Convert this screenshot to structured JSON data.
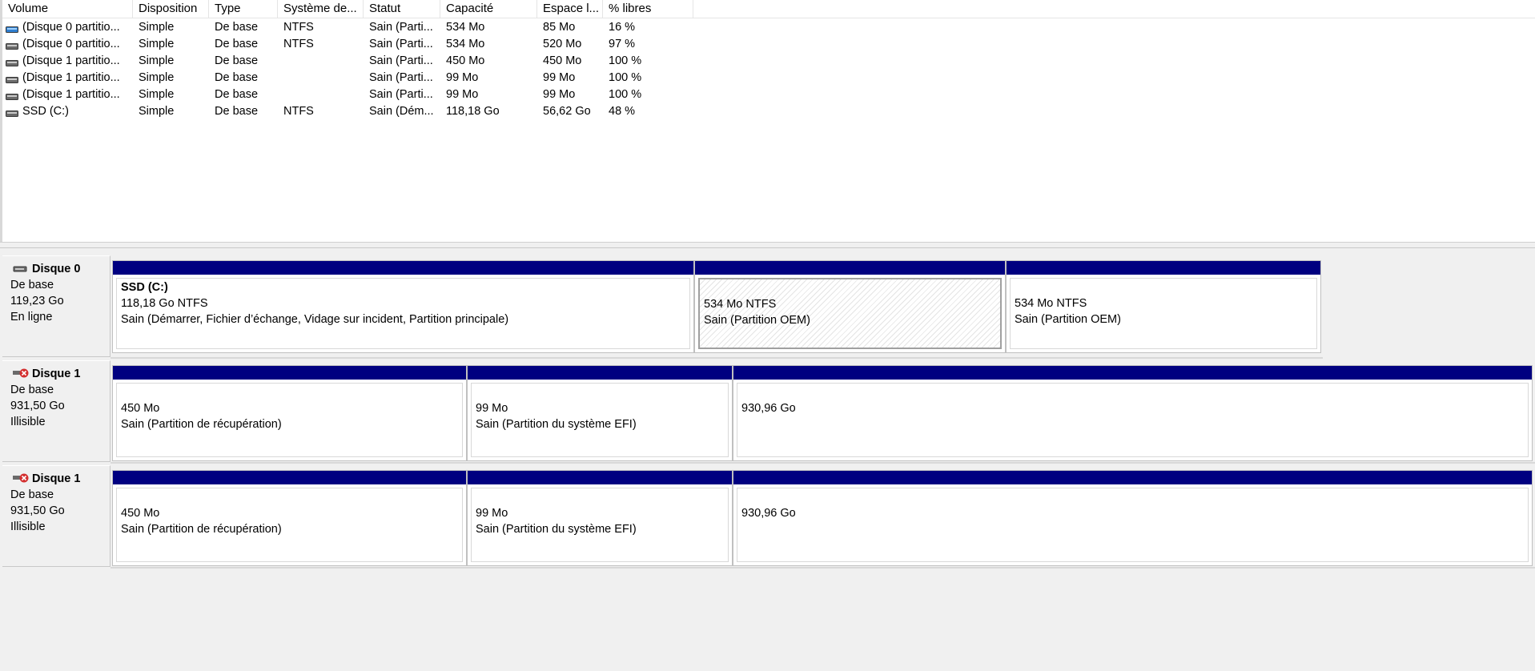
{
  "columns": [
    "Volume",
    "Disposition",
    "Type",
    "Système de...",
    "Statut",
    "Capacité",
    "Espace l...",
    "% libres"
  ],
  "volumes": [
    {
      "icon": "volume-blue-icon",
      "name": "(Disque 0 partitio...",
      "disposition": "Simple",
      "type": "De base",
      "fs": "NTFS",
      "status": "Sain (Parti...",
      "capacity": "534 Mo",
      "free": "85 Mo",
      "pct": "16 %"
    },
    {
      "icon": "volume-gray-icon",
      "name": "(Disque 0 partitio...",
      "disposition": "Simple",
      "type": "De base",
      "fs": "NTFS",
      "status": "Sain (Parti...",
      "capacity": "534 Mo",
      "free": "520 Mo",
      "pct": "97 %"
    },
    {
      "icon": "volume-gray-icon",
      "name": "(Disque 1 partitio...",
      "disposition": "Simple",
      "type": "De base",
      "fs": "",
      "status": "Sain (Parti...",
      "capacity": "450 Mo",
      "free": "450 Mo",
      "pct": "100 %"
    },
    {
      "icon": "volume-gray-icon",
      "name": "(Disque 1 partitio...",
      "disposition": "Simple",
      "type": "De base",
      "fs": "",
      "status": "Sain (Parti...",
      "capacity": "99 Mo",
      "free": "99 Mo",
      "pct": "100 %"
    },
    {
      "icon": "volume-gray-icon",
      "name": "(Disque 1 partitio...",
      "disposition": "Simple",
      "type": "De base",
      "fs": "",
      "status": "Sain (Parti...",
      "capacity": "99 Mo",
      "free": "99 Mo",
      "pct": "100 %"
    },
    {
      "icon": "volume-gray-icon",
      "name": "SSD (C:)",
      "disposition": "Simple",
      "type": "De base",
      "fs": "NTFS",
      "status": "Sain (Dém...",
      "capacity": "118,18 Go",
      "free": "56,62 Go",
      "pct": "48 %"
    }
  ],
  "disks": [
    {
      "name": "Disque 0",
      "type": "De base",
      "size": "119,23 Go",
      "state": "En ligne",
      "status_icon": "disk-online-icon",
      "partitions": [
        {
          "title": "SSD  (C:)",
          "line1": "118,18 Go NTFS",
          "line2": "Sain (Démarrer, Fichier d’échange, Vidage sur incident, Partition principale)",
          "selected": false
        },
        {
          "title": "",
          "line1": "534 Mo NTFS",
          "line2": "Sain (Partition OEM)",
          "selected": true
        },
        {
          "title": "",
          "line1": "534 Mo NTFS",
          "line2": "Sain (Partition OEM)",
          "selected": false
        }
      ]
    },
    {
      "name": "Disque 1",
      "type": "De base",
      "size": "931,50 Go",
      "state": "Illisible",
      "status_icon": "disk-error-icon",
      "partitions": [
        {
          "title": "",
          "line1": "450 Mo",
          "line2": "Sain (Partition de récupération)",
          "selected": false
        },
        {
          "title": "",
          "line1": "99 Mo",
          "line2": "Sain (Partition du système EFI)",
          "selected": false
        },
        {
          "title": "",
          "line1": "930,96 Go",
          "line2": "",
          "selected": false
        }
      ]
    },
    {
      "name": "Disque 1",
      "type": "De base",
      "size": "931,50 Go",
      "state": "Illisible",
      "status_icon": "disk-error-icon",
      "partitions": [
        {
          "title": "",
          "line1": "450 Mo",
          "line2": "Sain (Partition de récupération)",
          "selected": false
        },
        {
          "title": "",
          "line1": "99 Mo",
          "line2": "Sain (Partition du système EFI)",
          "selected": false
        },
        {
          "title": "",
          "line1": "930,96 Go",
          "line2": "",
          "selected": false
        }
      ]
    }
  ],
  "colors": {
    "partition_bar": "#000080",
    "error_badge": "#d32f2f",
    "volume_icon_blue": "#2f7fd0"
  }
}
